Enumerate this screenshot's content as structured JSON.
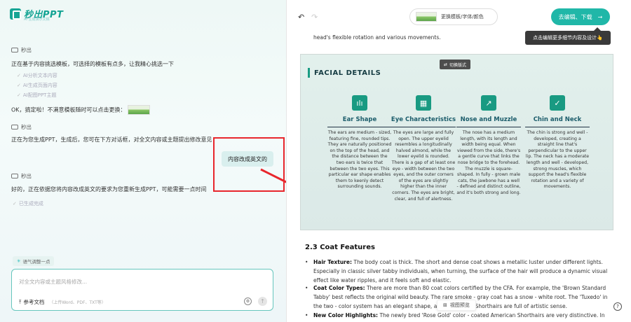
{
  "logo": {
    "name": "秒出PPT",
    "tagline": "AI 生成演示文稿"
  },
  "chat": {
    "sender1": "秒出",
    "msg1": "正在基于内容挑选模板，可选择的模板有点多，让我精心挑选一下",
    "sub_items": [
      "AI分析文本内容",
      "AI生成页面内容",
      "AI配图PPT主题"
    ],
    "msg2": "OK，搞定啦！不满意模板随时可以点击更换：",
    "sender2": "秒出",
    "msg3": "正在为您生成PPT，生成后，您可在下方对话框，对全文内容或主题提出修改意见",
    "user_msg": "内容改成英文的",
    "sender3": "秒出",
    "msg4": "好的，正在依据您将内容改成英文的要求为您重新生成PPT，可能需要一点时间",
    "status": "已生成完成"
  },
  "input": {
    "tone_chip": "语气调整一点",
    "placeholder": "对全文内容或主题风格修改...",
    "attach_label": "参考文档",
    "attach_hint": "（上传Word、PDF、TXT等）"
  },
  "toolbar": {
    "template_label": "更换模板/字体/颜色",
    "download_label": "去编辑、下载",
    "tooltip": "点击编辑更多细节内容及设计👆"
  },
  "doc": {
    "pre_text": "neck is of moderate length, with well - developed and strong muscles, supporting the head's flexible rotation and various movements.",
    "section_title": "2.3 Coat Features",
    "bullets": [
      {
        "label": "Hair Texture:",
        "text": " The body coat is thick. The short and dense coat shows a metallic luster under different lights. Especially in classic silver tabby individuals, when turning, the surface of the hair will produce a dynamic visual effect like water ripples, and it feels soft and elastic."
      },
      {
        "label": "Coat Color Types:",
        "text": " There are more than 80 coat colors certified by the CFA. For example, the 'Brown Standard Tabby' best reflects the original wild beauty. The rare smoke - gray coat has a snow - white root. The 'Tuxedo' in the two - color system has an elegant shape, and the milk ... Shorthairs are full of artistic sense."
      },
      {
        "label": "New Color Highlights:",
        "text": " The newly bred 'Rose Gold' color - coated American Shorthairs are very distinctive. In the sun,"
      }
    ],
    "preview_label": "视图预览"
  },
  "slide": {
    "switch_label": "切换版式",
    "title": "Facial Details",
    "cards": [
      {
        "icon": "ear-icon",
        "title": "Ear Shape",
        "body": "The ears are medium - sized, featuring fine, rounded tips. They are naturally positioned on the top of the head, and the distance between the two ears is twice that between the two eyes. This particular ear shape enables them to keenly detect surrounding sounds."
      },
      {
        "icon": "grid-icon",
        "title": "Eye Characteristics",
        "body": "The eyes are large and fully open. The upper eyelid resembles a longitudinally halved almond, while the lower eyelid is rounded. There is a gap of at least one eye - width between the two eyes, and the outer corners of the eyes are slightly higher than the inner corners. The eyes are bright, clear, and full of alertness."
      },
      {
        "icon": "trend-icon",
        "title": "Nose and Muzzle",
        "body": "The nose has a medium length, with its length and width being equal. When viewed from the side, there's a gentle curve that links the nose bridge to the forehead. The muzzle is square-shaped. In fully - grown male cats, the jawbone has a well - defined and distinct outline, and it's both strong and long."
      },
      {
        "icon": "check-icon",
        "title": "Chin and Neck",
        "body": "The chin is strong and well - developed, creating a straight line that's perpendicular to the upper lip. The neck has a moderate length and well - developed, strong muscles, which support the head's flexible rotation and a variety of movements."
      }
    ]
  }
}
